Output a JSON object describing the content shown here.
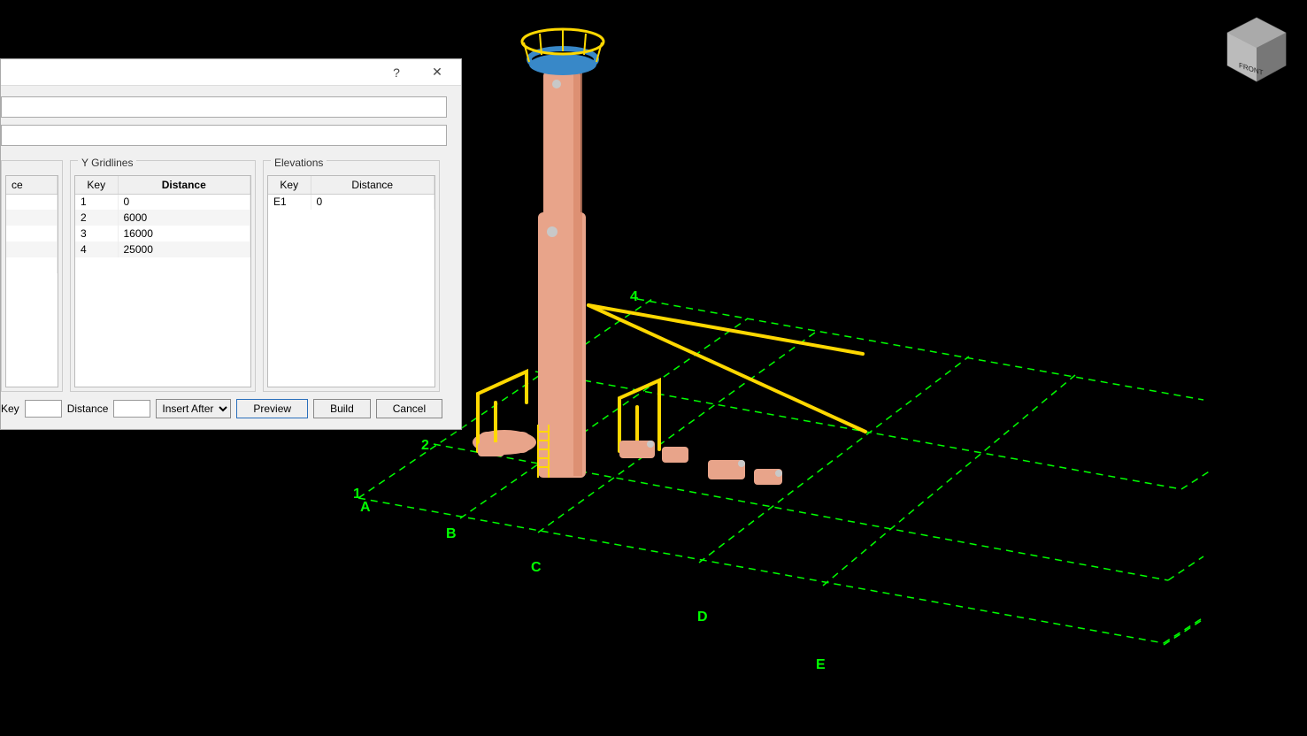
{
  "dialog": {
    "help_label": "?",
    "close_label": "✕",
    "input1_value": "",
    "input2_value": "",
    "panels": {
      "x": {
        "title": "",
        "col_distance_partial": "ce"
      },
      "y": {
        "title": "Y Gridlines",
        "col_key": "Key",
        "col_distance": "Distance",
        "rows": [
          {
            "key": "1",
            "distance": "0"
          },
          {
            "key": "2",
            "distance": "6000"
          },
          {
            "key": "3",
            "distance": "16000"
          },
          {
            "key": "4",
            "distance": "25000"
          }
        ]
      },
      "e": {
        "title": "Elevations",
        "col_key": "Key",
        "col_distance": "Distance",
        "rows": [
          {
            "key": "E1",
            "distance": "0"
          }
        ]
      }
    },
    "bottom": {
      "key_label": "Key",
      "key_value": "",
      "distance_label": "Distance",
      "distance_value": "",
      "insert_label": "Insert After",
      "preview_label": "Preview",
      "build_label": "Build",
      "cancel_label": "Cancel"
    }
  },
  "viewport": {
    "grid_x_labels": [
      "A",
      "B",
      "C",
      "D",
      "E"
    ],
    "grid_y_labels": [
      "1",
      "2",
      "4"
    ],
    "grid_color": "#00ff00",
    "pipe_color": "#ffd800",
    "tower_color": "#e8a48a",
    "top_ring_color": "#3888c8"
  },
  "viewcube": {
    "front_label": "FRONT"
  }
}
